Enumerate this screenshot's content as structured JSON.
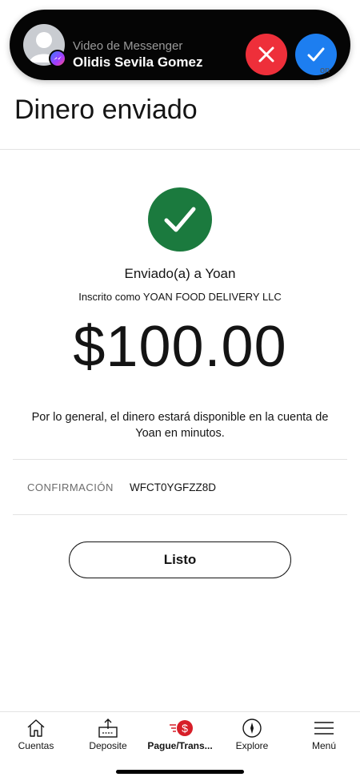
{
  "call_banner": {
    "source": "Video de Messenger",
    "caller_name": "Olidis Sevila Gomez",
    "icons": [
      "avatar-placeholder-icon",
      "messenger-icon",
      "close-icon",
      "check-icon"
    ],
    "colors": {
      "decline": "#ee2f3a",
      "accept": "#1d7ef0",
      "background": "#050505"
    }
  },
  "banner_peek_text": "on",
  "page": {
    "title": "Dinero enviado"
  },
  "receipt": {
    "status_icon": "check-circle-icon",
    "status_color": "#1b7a3e",
    "sent_to": "Enviado(a) a Yoan",
    "registered_as": "Inscrito como YOAN FOOD DELIVERY LLC",
    "amount": "$100.00",
    "availability_note": "Por lo general, el dinero estará disponible en la cuenta de Yoan en minutos.",
    "confirmation_label": "CONFIRMACIÓN",
    "confirmation_code": "WFCT0YGFZZ8D",
    "done_label": "Listo"
  },
  "bottom_nav": {
    "items": [
      {
        "label": "Cuentas",
        "icon": "home-icon"
      },
      {
        "label": "Deposite",
        "icon": "deposit-icon"
      },
      {
        "label": "Pague/Trans...",
        "icon": "pay-transfer-icon",
        "active": true
      },
      {
        "label": "Explore",
        "icon": "compass-icon"
      },
      {
        "label": "Menú",
        "icon": "menu-icon"
      }
    ],
    "accent_color": "#d71e28"
  }
}
